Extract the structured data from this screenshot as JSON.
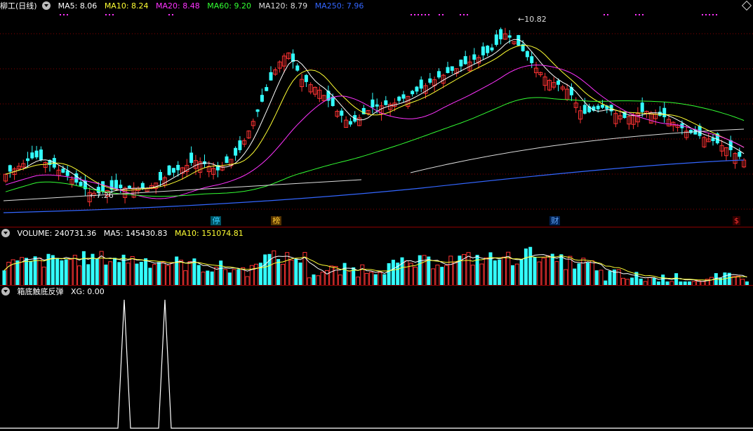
{
  "main": {
    "title": "柳工(日线)",
    "ma": [
      {
        "label": "MA5",
        "value": "8.06",
        "color": "#ffffff"
      },
      {
        "label": "MA10",
        "value": "8.24",
        "color": "#ffff33"
      },
      {
        "label": "MA20",
        "value": "8.48",
        "color": "#ff33ff"
      },
      {
        "label": "MA60",
        "value": "9.20",
        "color": "#33ff33"
      },
      {
        "label": "MA120",
        "value": "8.79",
        "color": "#dddddd"
      },
      {
        "label": "MA250",
        "value": "7.96",
        "color": "#3366ff"
      }
    ],
    "high_label": "10.82",
    "low_label": "7.26",
    "event_marks": [
      {
        "text": "停",
        "color": "#33ccff",
        "bg": "#005566",
        "pos": 0.28
      },
      {
        "text": "榜",
        "color": "#ffcc33",
        "bg": "#553300",
        "pos": 0.36
      },
      {
        "text": "财",
        "color": "#66aaff",
        "bg": "#002255",
        "pos": 0.73
      },
      {
        "text": "$",
        "color": "#ff3333",
        "bg": "#330000",
        "pos": 0.973
      }
    ]
  },
  "volume": {
    "label": "VOLUME",
    "value": "240731.36",
    "ma5_label": "MA5",
    "ma5_value": "145430.83",
    "ma10_label": "MA10",
    "ma10_value": "151074.81"
  },
  "indicator": {
    "name": "箱底触底反弹",
    "xg_label": "XG",
    "xg_value": "0.00"
  },
  "colors": {
    "up": "#ff3333",
    "down": "#33ffff",
    "grid": "#8b0000"
  }
}
